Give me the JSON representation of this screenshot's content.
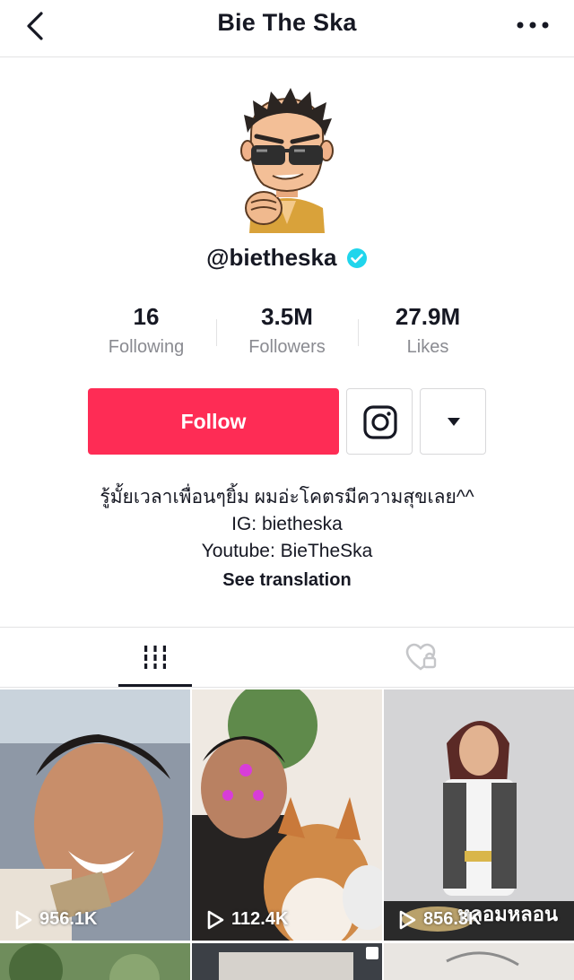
{
  "header": {
    "title": "Bie The Ska"
  },
  "profile": {
    "handle": "@bietheska",
    "verified": true
  },
  "stats": [
    {
      "value": "16",
      "label": "Following"
    },
    {
      "value": "3.5M",
      "label": "Followers"
    },
    {
      "value": "27.9M",
      "label": "Likes"
    }
  ],
  "actions": {
    "follow_label": "Follow"
  },
  "bio": {
    "line1": "รู้มั้ยเวลาเพื่อนๆยิ้ม ผมอ่ะโคตรมีความสุขเลย^^",
    "line2": "IG: bietheska",
    "line3": "Youtube: BieTheSka",
    "see_translation": "See translation"
  },
  "videos": [
    {
      "views": "956.1K"
    },
    {
      "views": "112.4K"
    },
    {
      "views": "856.3K",
      "caption": "หลอมหลอน"
    }
  ],
  "colors": {
    "accent": "#fe2c55",
    "verified": "#20d5ec",
    "text": "#161823",
    "muted": "#8a8b91"
  }
}
